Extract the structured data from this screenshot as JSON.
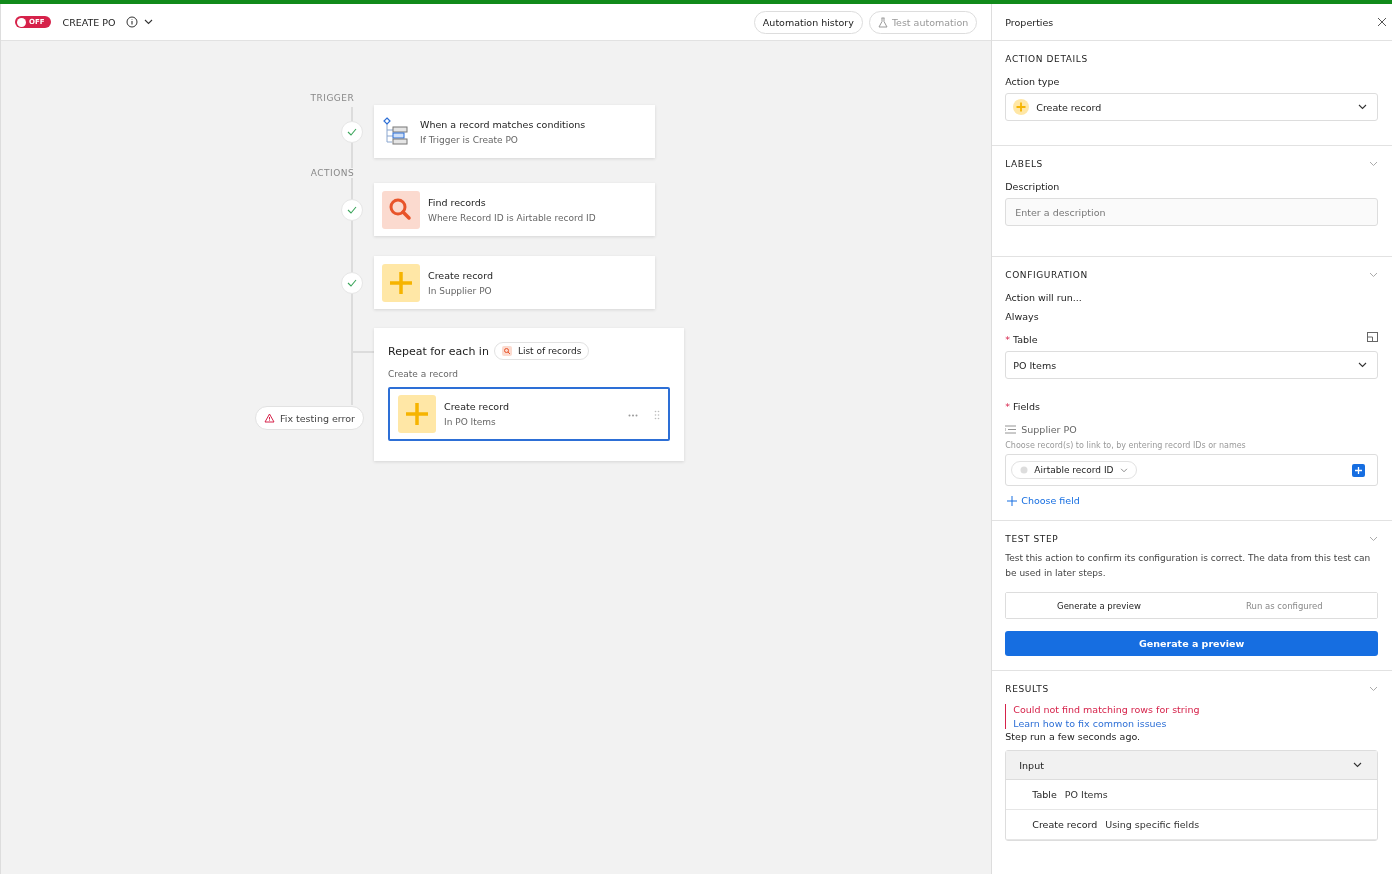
{
  "top_bar": {
    "toggle": {
      "label": "OFF",
      "on": false
    },
    "title": "CREATE PO",
    "buttons": [
      {
        "label": "Automation history",
        "disabled": false,
        "kind": "plain"
      },
      {
        "label": "Test automation",
        "disabled": true,
        "kind": "flask"
      }
    ]
  },
  "canvas": {
    "trigger_label": "TRIGGER",
    "actions_label": "ACTIONS",
    "steps": [
      {
        "kind": "trigger",
        "title": "When a record matches conditions",
        "subtitle": "If Trigger is Create PO",
        "done": true
      },
      {
        "kind": "find",
        "title": "Find records",
        "subtitle": "Where Record ID is Airtable record ID",
        "done": true
      },
      {
        "kind": "create",
        "title": "Create record",
        "subtitle": "In Supplier PO",
        "done": true
      }
    ],
    "repeat": {
      "title": "Repeat for each in",
      "chip": "List of records",
      "subtitle": "Create a record",
      "step": {
        "kind": "create",
        "title": "Create record",
        "subtitle": "In PO Items",
        "selected": true
      }
    },
    "error_button": "Fix testing error"
  },
  "properties": {
    "title": "Properties",
    "action_details": {
      "heading": "ACTION DETAILS",
      "label": "Action type",
      "value": "Create record"
    },
    "labels": {
      "heading": "LABELS",
      "label": "Description",
      "placeholder": "Enter a description"
    },
    "configuration": {
      "heading": "CONFIGURATION",
      "run_label": "Action will run...",
      "run_value": "Always",
      "required_mark": "*",
      "table_label": "Table",
      "table_value": "PO Items",
      "fields_label": "Fields",
      "field_name": "Supplier PO",
      "field_hint": "Choose record(s) to link to, by entering record IDs or names",
      "field_token": "Airtable record ID",
      "choose_field": "Choose field"
    },
    "test_step": {
      "heading": "TEST STEP",
      "text": "Test this action to confirm its configuration is correct. The data from this test can be used in later steps.",
      "modes": [
        {
          "label": "Generate a preview",
          "selected": true
        },
        {
          "label": "Run as configured",
          "selected": false
        }
      ],
      "button": "Generate a preview"
    },
    "results": {
      "heading": "RESULTS",
      "error": "Could not find matching rows for string",
      "help_link": "Learn how to fix common issues",
      "status": "Step run a few seconds ago.",
      "input_heading": "Input",
      "rows": [
        {
          "key": "Table",
          "value": "PO Items"
        },
        {
          "key": "Create record",
          "value": "Using specific fields"
        }
      ]
    }
  }
}
